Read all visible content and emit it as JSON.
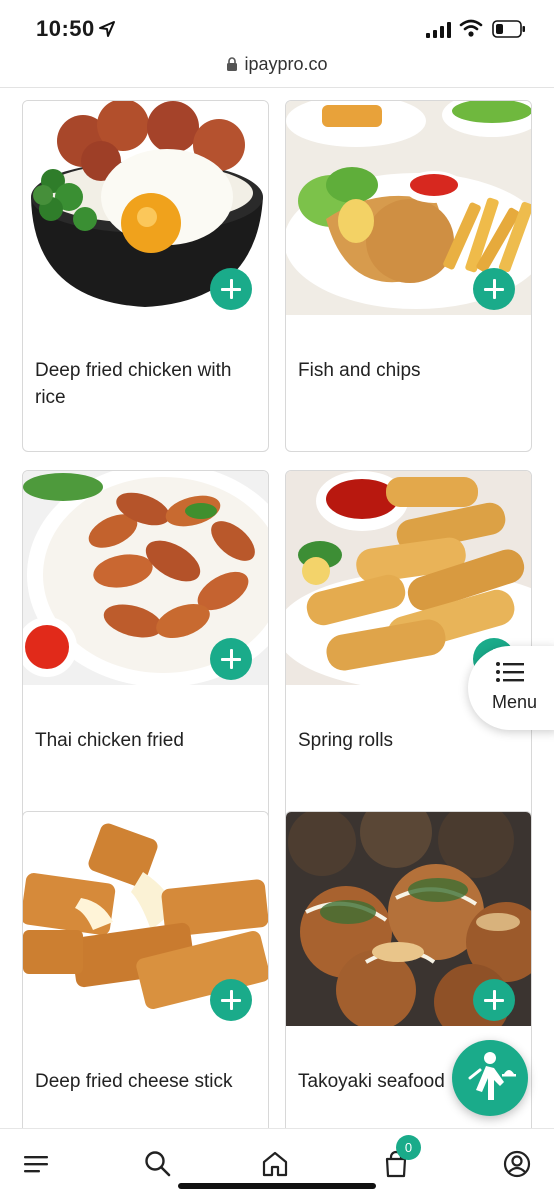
{
  "status_bar": {
    "time": "10:50"
  },
  "browser": {
    "url": "ipaypro.co"
  },
  "items": [
    {
      "title": "Deep fried chicken with rice"
    },
    {
      "title": "Fish and chips"
    },
    {
      "title": "Thai chicken fried"
    },
    {
      "title": "Spring rolls"
    },
    {
      "title": "Deep fried cheese stick"
    },
    {
      "title": "Takoyaki seafood"
    }
  ],
  "menu_tab": {
    "label": "Menu"
  },
  "cart": {
    "count": "0"
  },
  "colors": {
    "accent": "#1aab8a"
  },
  "icons": [
    "location-arrow-icon",
    "signal-icon",
    "wifi-icon",
    "battery-icon",
    "lock-icon",
    "plus-icon",
    "menu-list-icon",
    "waiter-icon",
    "hamburger-icon",
    "search-icon",
    "home-icon",
    "cart-icon",
    "profile-icon"
  ]
}
